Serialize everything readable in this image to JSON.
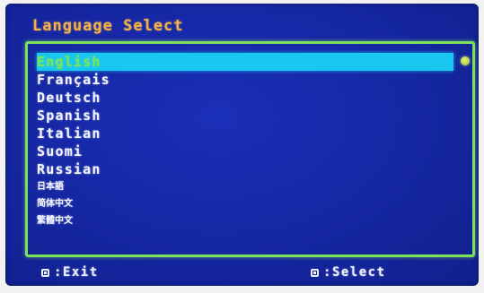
{
  "menu": {
    "title": "Language Select",
    "languages": [
      {
        "label": "English",
        "selected": true
      },
      {
        "label": "Français"
      },
      {
        "label": "Deutsch"
      },
      {
        "label": "Spanish"
      },
      {
        "label": "Italian"
      },
      {
        "label": "Suomi"
      },
      {
        "label": "Russian"
      },
      {
        "label": "日本語"
      },
      {
        "label": "简体中文"
      },
      {
        "label": "繁體中文"
      }
    ]
  },
  "footer": {
    "exit_label": "Exit",
    "exit_separator": ":",
    "select_label": "Select",
    "select_separator": ":"
  },
  "colors": {
    "background": "#1628a6",
    "title": "#f2b24a",
    "border": "#7de05a",
    "highlight": "#19c8f0",
    "selected_text": "#7de25c",
    "text": "#f4f6ff"
  },
  "icons": {
    "scroll_indicator": "scroll-indicator-icon",
    "exit_key": "key-button-icon",
    "select_key": "key-button-icon"
  }
}
